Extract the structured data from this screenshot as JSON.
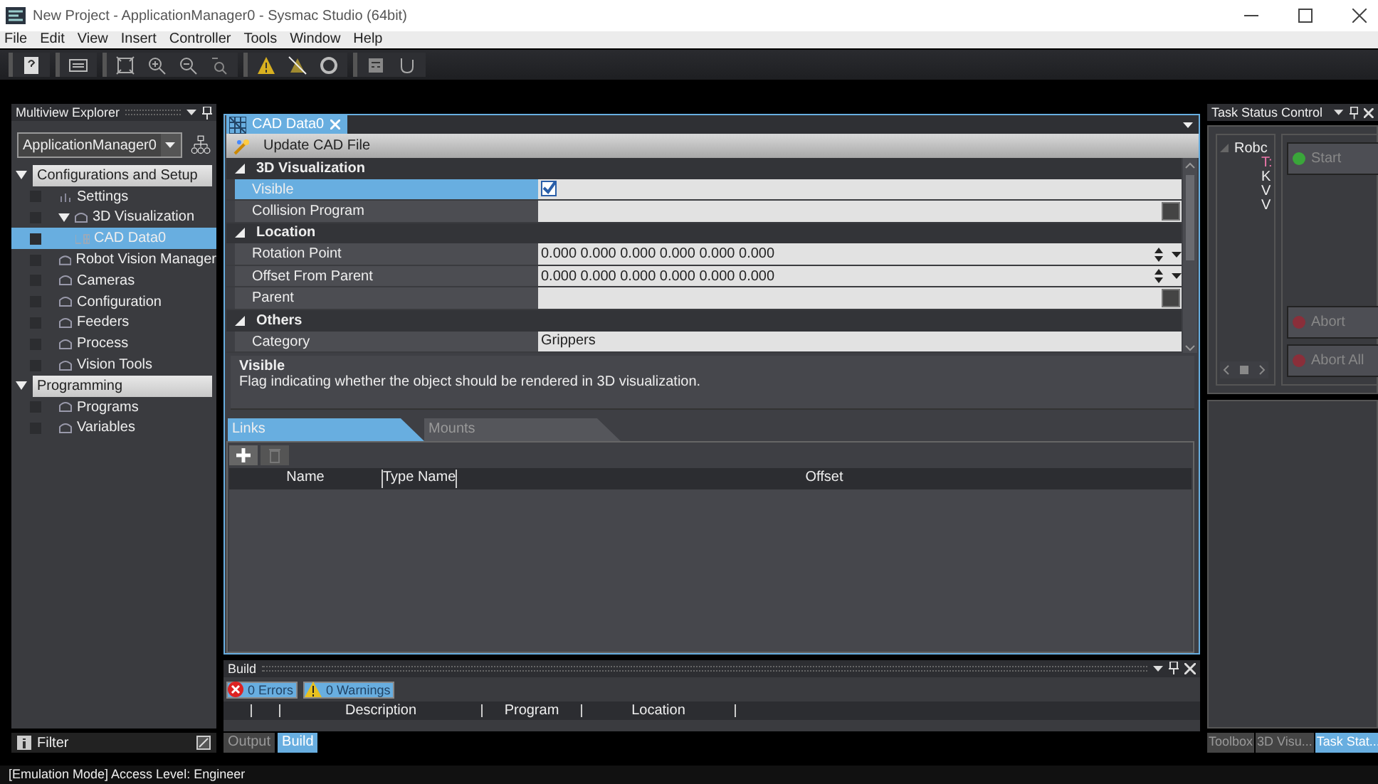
{
  "window": {
    "title": "New Project - ApplicationManager0 - Sysmac Studio (64bit)"
  },
  "menu": [
    "File",
    "Edit",
    "View",
    "Insert",
    "Controller",
    "Tools",
    "Window",
    "Help"
  ],
  "explorer": {
    "title": "Multiview Explorer",
    "selector": "ApplicationManager0",
    "tree": [
      {
        "label": "Configurations and Setup",
        "kind": "group",
        "expanded": true,
        "selected": false,
        "children": [
          {
            "label": "Settings",
            "kind": "settings",
            "selected": false
          },
          {
            "label": "3D Visualization",
            "kind": "folder",
            "expanded": true,
            "selected": false,
            "children": [
              {
                "label": "CAD Data0",
                "kind": "cad",
                "selected": true
              }
            ]
          },
          {
            "label": "Robot Vision Manager",
            "kind": "folder",
            "selected": false
          },
          {
            "label": "Cameras",
            "kind": "folder",
            "selected": false
          },
          {
            "label": "Configuration",
            "kind": "folder",
            "selected": false
          },
          {
            "label": "Feeders",
            "kind": "folder",
            "selected": false
          },
          {
            "label": "Process",
            "kind": "folder",
            "selected": false
          },
          {
            "label": "Vision Tools",
            "kind": "folder",
            "selected": false
          }
        ]
      },
      {
        "label": "Programming",
        "kind": "group",
        "expanded": true,
        "selected": false,
        "children": [
          {
            "label": "Programs",
            "kind": "folder",
            "selected": false
          },
          {
            "label": "Variables",
            "kind": "folder",
            "selected": false
          }
        ]
      }
    ],
    "filter": "Filter"
  },
  "editor": {
    "tabs": [
      {
        "label": "CAD Data0",
        "selected": true
      }
    ],
    "update_button": "Update CAD File",
    "sections": [
      {
        "title": "3D Visualization",
        "expanded": true,
        "rows": [
          {
            "name": "Visible",
            "kind": "checkbox",
            "checked": true,
            "selected": true
          },
          {
            "name": "Collision Program",
            "kind": "browse",
            "value": "",
            "selected": false
          }
        ]
      },
      {
        "title": "Location",
        "expanded": true,
        "rows": [
          {
            "name": "Rotation Point",
            "kind": "spin",
            "value": "0.000 0.000 0.000 0.000 0.000 0.000",
            "selected": false
          },
          {
            "name": "Offset From Parent",
            "kind": "spin",
            "value": "0.000 0.000 0.000 0.000 0.000 0.000",
            "selected": false
          },
          {
            "name": "Parent",
            "kind": "browse",
            "value": "",
            "selected": false
          }
        ]
      },
      {
        "title": "Others",
        "expanded": true,
        "rows": [
          {
            "name": "Category",
            "kind": "text",
            "value": "Grippers",
            "selected": false
          }
        ]
      }
    ],
    "description": {
      "title": "Visible",
      "text": "Flag indicating whether the object should be rendered in 3D visualization."
    },
    "sub_tabs": [
      {
        "label": "Links",
        "selected": true
      },
      {
        "label": "Mounts",
        "selected": false
      }
    ],
    "links_columns": [
      "Name",
      "Type Name",
      "Offset"
    ]
  },
  "build": {
    "title": "Build",
    "errors": "0  Errors",
    "warnings": "0  Warnings",
    "columns": [
      "Description",
      "Program",
      "Location"
    ]
  },
  "bottom_tabs": [
    {
      "label": "Output",
      "selected": false
    },
    {
      "label": "Build",
      "selected": true
    }
  ],
  "task_status": {
    "title": "Task Status Control",
    "tree": [
      "Robc",
      "T:",
      "K",
      "V",
      "V"
    ],
    "buttons": [
      {
        "label": "Start",
        "color": "#3aa63a"
      },
      {
        "label": "Abort",
        "color": "#8a2f3a"
      },
      {
        "label": "Abort All",
        "color": "#8a2f3a"
      }
    ]
  },
  "right_tabs": [
    {
      "label": "Toolbox",
      "selected": false
    },
    {
      "label": "3D Visu...",
      "selected": false
    },
    {
      "label": "Task Stat...",
      "selected": true
    }
  ],
  "status_bar": "[Emulation Mode] Access Level: Engineer"
}
